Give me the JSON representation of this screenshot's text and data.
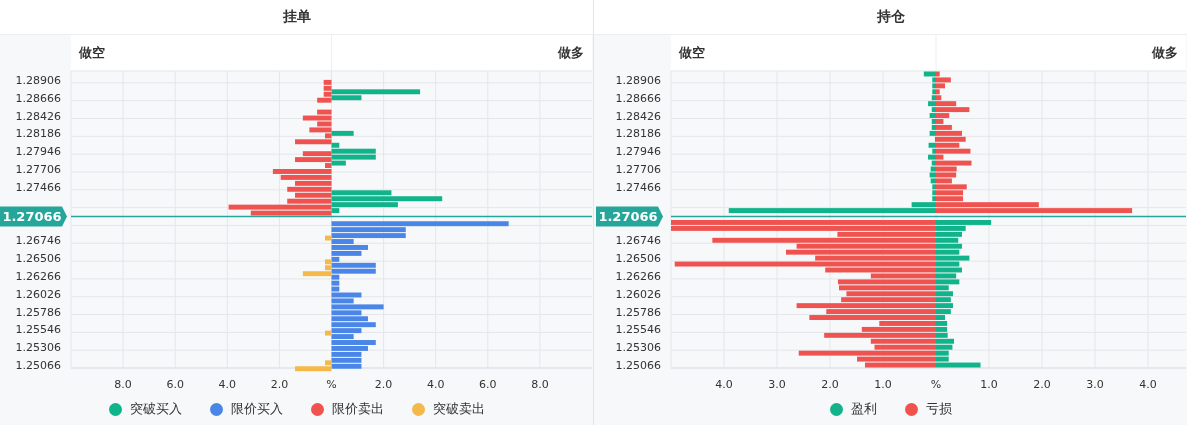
{
  "panels": [
    {
      "title": "挂单",
      "short_label": "做空",
      "long_label": "做多",
      "chart_data": {
        "type": "bar",
        "orientation": "horizontal",
        "grid": true,
        "xlim": [
          -10,
          10
        ],
        "categories": [
          null,
          "1.28906",
          null,
          null,
          "1.28666",
          null,
          null,
          "1.28426",
          null,
          null,
          "1.28186",
          null,
          null,
          "1.27946",
          null,
          null,
          "1.27706",
          null,
          null,
          "1.27466",
          null,
          null,
          null,
          null,
          "1.27066",
          null,
          null,
          null,
          "1.26746",
          null,
          null,
          "1.26506",
          null,
          null,
          "1.26266",
          null,
          null,
          "1.26026",
          null,
          null,
          "1.25786",
          null,
          null,
          "1.25546",
          null,
          null,
          "1.25306",
          null,
          null,
          "1.25066"
        ],
        "xticks": [
          {
            "value": -8,
            "label": "8.0"
          },
          {
            "value": -6,
            "label": "6.0"
          },
          {
            "value": -4,
            "label": "4.0"
          },
          {
            "value": -2,
            "label": "2.0"
          },
          {
            "value": 0,
            "label": "%"
          },
          {
            "value": 2,
            "label": "2.0"
          },
          {
            "value": 4,
            "label": "4.0"
          },
          {
            "value": 6,
            "label": "6.0"
          },
          {
            "value": 8,
            "label": "8.0"
          }
        ],
        "series": [
          {
            "name": "突破买入",
            "color": "#10b38a",
            "values": [
              null,
              null,
              null,
              3.4,
              1.15,
              null,
              null,
              null,
              null,
              null,
              0.85,
              null,
              0.3,
              1.7,
              1.7,
              0.55,
              null,
              null,
              null,
              null,
              2.3,
              4.25,
              2.55,
              0.3,
              null,
              null,
              null,
              null,
              null,
              null,
              null,
              null,
              null,
              null,
              null,
              null,
              null,
              null,
              null,
              null,
              null,
              null,
              null,
              null,
              null,
              null,
              null,
              null,
              null,
              null
            ]
          },
          {
            "name": "限价买入",
            "color": "#4a86e8",
            "values": [
              null,
              null,
              null,
              null,
              null,
              null,
              null,
              null,
              null,
              null,
              null,
              null,
              null,
              null,
              null,
              null,
              null,
              null,
              null,
              null,
              null,
              null,
              null,
              null,
              null,
              6.8,
              2.85,
              2.85,
              0.85,
              1.4,
              1.15,
              0.3,
              1.7,
              1.7,
              0.3,
              0.3,
              0.3,
              1.15,
              0.85,
              2.0,
              1.15,
              1.4,
              1.7,
              1.15,
              0.85,
              1.7,
              1.4,
              1.15,
              1.15,
              1.15
            ]
          },
          {
            "name": "限价卖出",
            "color": "#ef5350",
            "values": [
              null,
              -0.3,
              -0.3,
              -0.3,
              -0.55,
              null,
              -0.55,
              -1.1,
              -0.55,
              -0.85,
              -0.25,
              -1.4,
              null,
              -1.1,
              -1.4,
              -0.25,
              -2.25,
              -1.95,
              -1.4,
              -1.7,
              -1.4,
              -1.7,
              -3.95,
              -3.1,
              null,
              null,
              null,
              null,
              null,
              null,
              null,
              null,
              null,
              null,
              null,
              null,
              null,
              null,
              null,
              null,
              null,
              null,
              null,
              null,
              null,
              null,
              null,
              null,
              null,
              null
            ]
          },
          {
            "name": "突破卖出",
            "color": "#f5b94a",
            "values": [
              null,
              null,
              null,
              null,
              null,
              null,
              null,
              null,
              null,
              null,
              null,
              null,
              null,
              null,
              null,
              null,
              null,
              null,
              null,
              null,
              null,
              null,
              null,
              null,
              null,
              null,
              null,
              -0.25,
              null,
              null,
              null,
              -0.25,
              -0.25,
              -1.1,
              null,
              null,
              null,
              null,
              null,
              null,
              null,
              null,
              null,
              -0.25,
              null,
              null,
              null,
              null,
              -0.25,
              -1.4
            ]
          }
        ],
        "ref_lines": [
          {
            "axis": "y",
            "value": "1.27066",
            "color": "#26a69a"
          }
        ]
      }
    },
    {
      "title": "持仓",
      "short_label": "做空",
      "long_label": "做多",
      "chart_data": {
        "type": "bar",
        "orientation": "horizontal",
        "grid": true,
        "stacked": true,
        "xlim": [
          -5,
          5
        ],
        "categories": [
          null,
          "1.28906",
          null,
          null,
          "1.28666",
          null,
          null,
          "1.28426",
          null,
          null,
          "1.28186",
          null,
          null,
          "1.27946",
          null,
          null,
          "1.27706",
          null,
          null,
          "1.27466",
          null,
          null,
          null,
          null,
          "1.27066",
          null,
          null,
          null,
          "1.26746",
          null,
          null,
          "1.26506",
          null,
          null,
          "1.26266",
          null,
          null,
          "1.26026",
          null,
          null,
          "1.25786",
          null,
          null,
          "1.25546",
          null,
          null,
          "1.25306",
          null,
          null,
          "1.25066"
        ],
        "xticks": [
          {
            "value": -4,
            "label": "4.0"
          },
          {
            "value": -3,
            "label": "3.0"
          },
          {
            "value": -2,
            "label": "2.0"
          },
          {
            "value": -1,
            "label": "1.0"
          },
          {
            "value": 0,
            "label": "%"
          },
          {
            "value": 1,
            "label": "1.0"
          },
          {
            "value": 2,
            "label": "2.0"
          },
          {
            "value": 3,
            "label": "3.0"
          },
          {
            "value": 4,
            "label": "4.0"
          }
        ],
        "series": [
          {
            "name": "盈利",
            "color": "#10b38a",
            "values": [
              -0.23,
              -0.07,
              -0.07,
              -0.07,
              -0.08,
              -0.15,
              -0.08,
              -0.12,
              -0.08,
              -0.08,
              -0.12,
              -0.02,
              -0.14,
              -0.07,
              -0.15,
              -0.08,
              -0.1,
              -0.12,
              -0.1,
              -0.07,
              -0.07,
              -0.07,
              -0.46,
              -3.91,
              null,
              1.04,
              0.56,
              0.49,
              0.42,
              0.49,
              0.44,
              0.63,
              0.44,
              0.49,
              0.38,
              0.44,
              0.24,
              0.32,
              0.28,
              0.32,
              0.28,
              0.17,
              0.21,
              0.21,
              0.22,
              0.34,
              0.31,
              0.24,
              0.24,
              0.84
            ]
          },
          {
            "name": "亏损",
            "color": "#ef5350",
            "values": [
              0.07,
              0.28,
              0.17,
              0.07,
              0.1,
              0.38,
              0.63,
              0.25,
              0.14,
              0.3,
              0.49,
              0.56,
              0.44,
              0.65,
              0.14,
              0.67,
              0.39,
              0.38,
              0.3,
              0.58,
              0.51,
              0.51,
              1.94,
              3.7,
              null,
              -5,
              -5,
              -1.86,
              -4.22,
              -2.63,
              -2.83,
              -2.28,
              -4.93,
              -2.09,
              -1.23,
              -1.85,
              -1.83,
              -1.69,
              -1.79,
              -2.63,
              -2.07,
              -2.39,
              -1.07,
              -1.4,
              -2.11,
              -1.23,
              -1.16,
              -2.59,
              -1.49,
              -1.34
            ]
          }
        ],
        "ref_lines": [
          {
            "axis": "y",
            "value": "1.27066",
            "color": "#26a69a"
          }
        ]
      }
    }
  ]
}
